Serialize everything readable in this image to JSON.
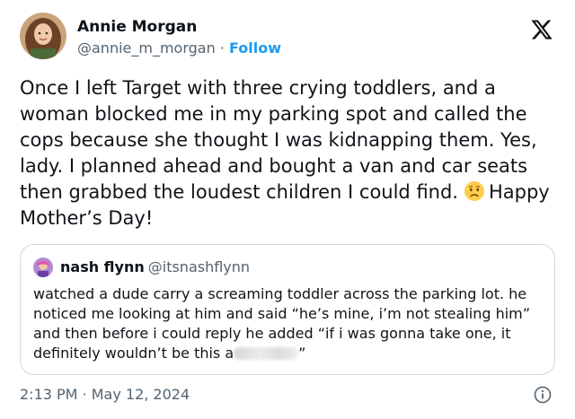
{
  "tweet": {
    "author_name": "Annie Morgan",
    "author_handle": "@annie_m_morgan",
    "separator": " · ",
    "follow_label": "Follow",
    "text_before_emoji": "Once I left Target with three crying toddlers, and a woman blocked me in my parking spot and called the cops because she thought I was kidnapping them. Yes, lady. I planned ahead and bought a van and car seats then grabbed the loudest children I could find.",
    "emoji": "disappointed-face",
    "text_after_emoji": "Happy Mother’s Day!",
    "timestamp": "2:13 PM · May 12, 2024"
  },
  "quoted_tweet": {
    "author_name": "nash flynn",
    "author_handle": "@itsnashflynn",
    "text_before_redaction": "watched a dude carry a screaming toddler across the parking lot. he noticed me looking at him and said “he’s mine, i’m not stealing him” and then before i could reply he added “if i was gonna take one, it definitely wouldn’t be this a",
    "text_after_redaction": "”"
  },
  "icons": {
    "platform_logo": "x-logo",
    "info": "info-icon",
    "accent_color": "#1d9bf0"
  }
}
